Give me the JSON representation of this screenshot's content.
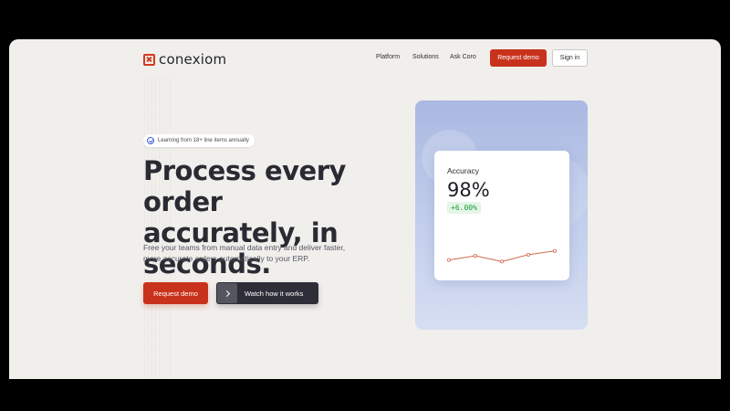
{
  "brand": {
    "name": "conexiom",
    "accent": "#c8321c"
  },
  "nav": {
    "items": [
      "Platform",
      "Solutions",
      "Ask Coro"
    ],
    "request_demo": "Request demo",
    "sign_in": "Sign in"
  },
  "hero": {
    "badge": "Learning from 18+ line items annually",
    "headline": "Process every order accurately, in seconds.",
    "subcopy": "Free your teams from manual data entry and deliver faster, more accurate orders automatically to your ERP.",
    "primary_cta": "Request demo",
    "secondary_cta": "Watch how it works"
  },
  "metric_card": {
    "title": "Accuracy",
    "value": "98%",
    "delta": "+6.00%",
    "delta_color": "#1a9a3a",
    "line_color": "#d06a52",
    "sparkline": [
      0.3,
      0.55,
      0.2,
      0.62,
      0.85
    ]
  }
}
